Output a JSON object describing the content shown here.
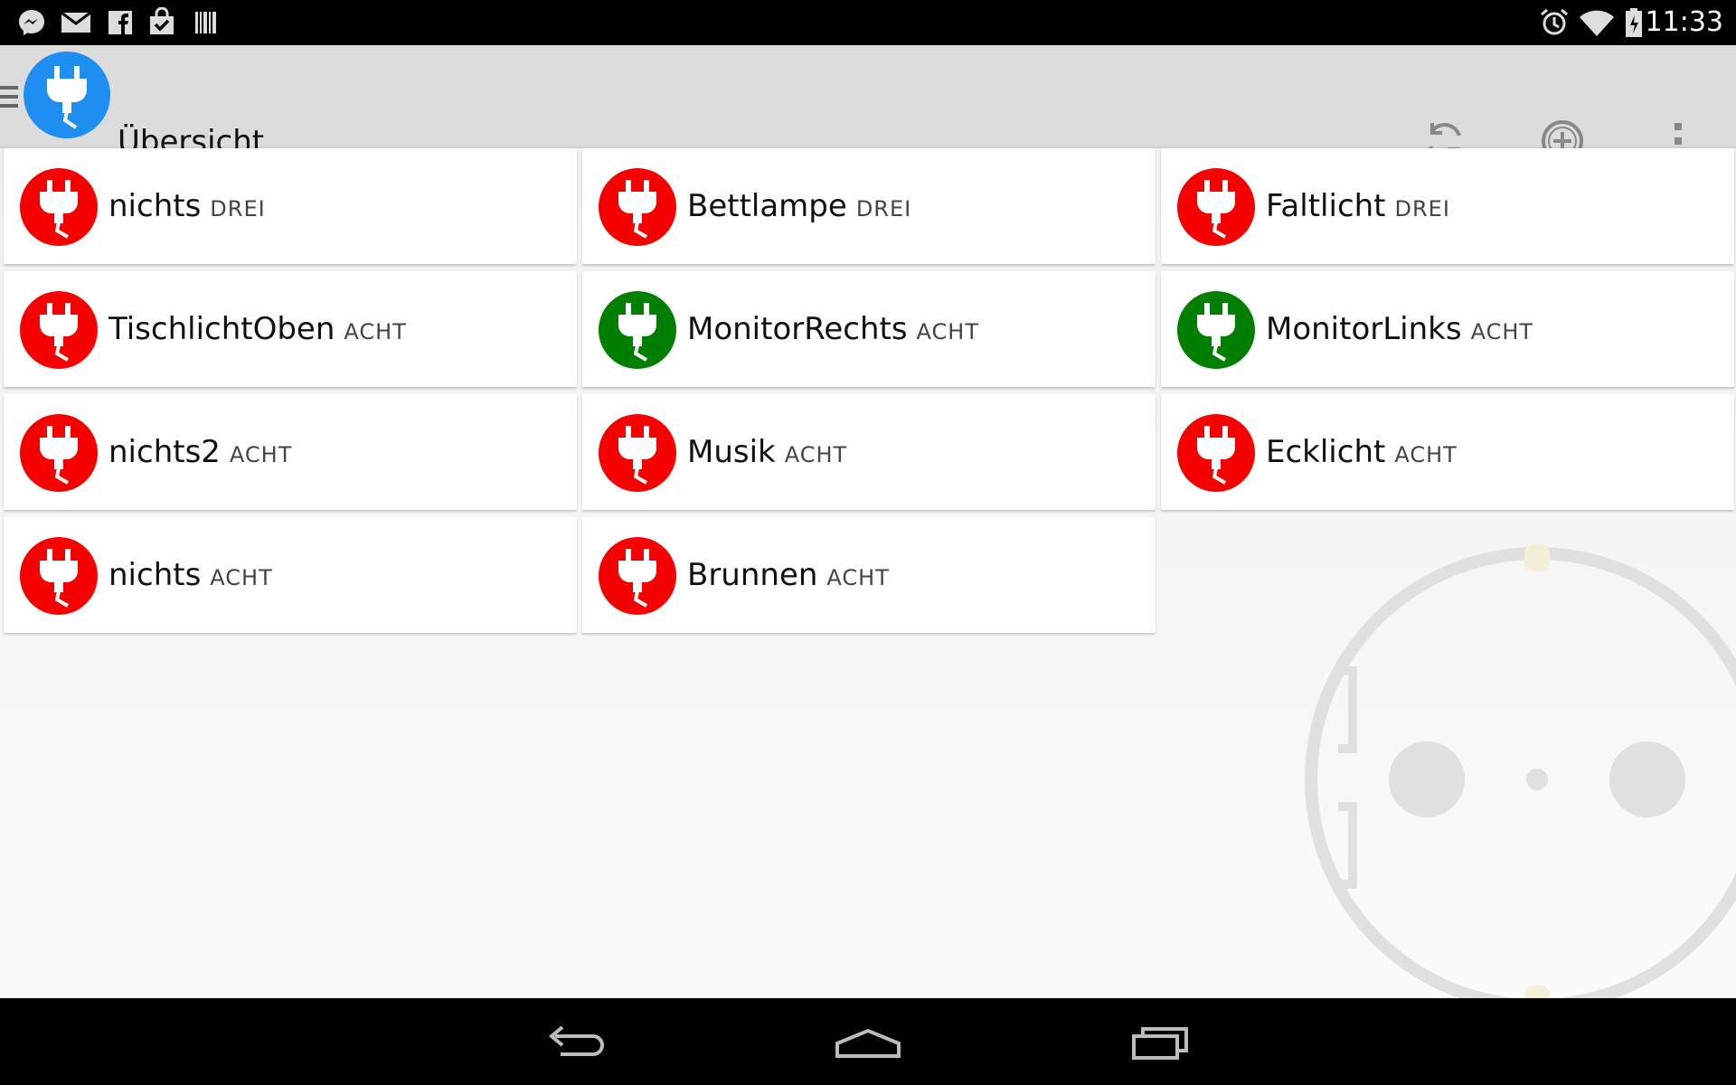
{
  "status_bar": {
    "time": "11:33",
    "left_icons": [
      "messenger-icon",
      "mail-icon",
      "facebook-icon",
      "shopping-bag-check-icon",
      "barcode-icon"
    ],
    "right_icons": [
      "alarm-icon",
      "wifi-icon",
      "battery-icon"
    ]
  },
  "action_bar": {
    "title": "Übersicht",
    "actions": [
      "refresh-icon",
      "add-icon",
      "overflow-menu-icon"
    ]
  },
  "colors": {
    "off": "#f70000",
    "on": "#007f00",
    "logo": "#1e8ff0"
  },
  "devices": [
    {
      "name": "nichts",
      "group": "DREI",
      "state": "off"
    },
    {
      "name": "Bettlampe",
      "group": "DREI",
      "state": "off"
    },
    {
      "name": "Faltlicht",
      "group": "DREI",
      "state": "off"
    },
    {
      "name": "TischlichtOben",
      "group": "ACHT",
      "state": "off"
    },
    {
      "name": "MonitorRechts",
      "group": "ACHT",
      "state": "on"
    },
    {
      "name": "MonitorLinks",
      "group": "ACHT",
      "state": "on"
    },
    {
      "name": "nichts2",
      "group": "ACHT",
      "state": "off"
    },
    {
      "name": "Musik",
      "group": "ACHT",
      "state": "off"
    },
    {
      "name": "Ecklicht",
      "group": "ACHT",
      "state": "off"
    },
    {
      "name": "nichts",
      "group": "ACHT",
      "state": "off"
    },
    {
      "name": "Brunnen",
      "group": "ACHT",
      "state": "off"
    }
  ],
  "nav_bar": [
    "back-icon",
    "home-icon",
    "recents-icon"
  ]
}
